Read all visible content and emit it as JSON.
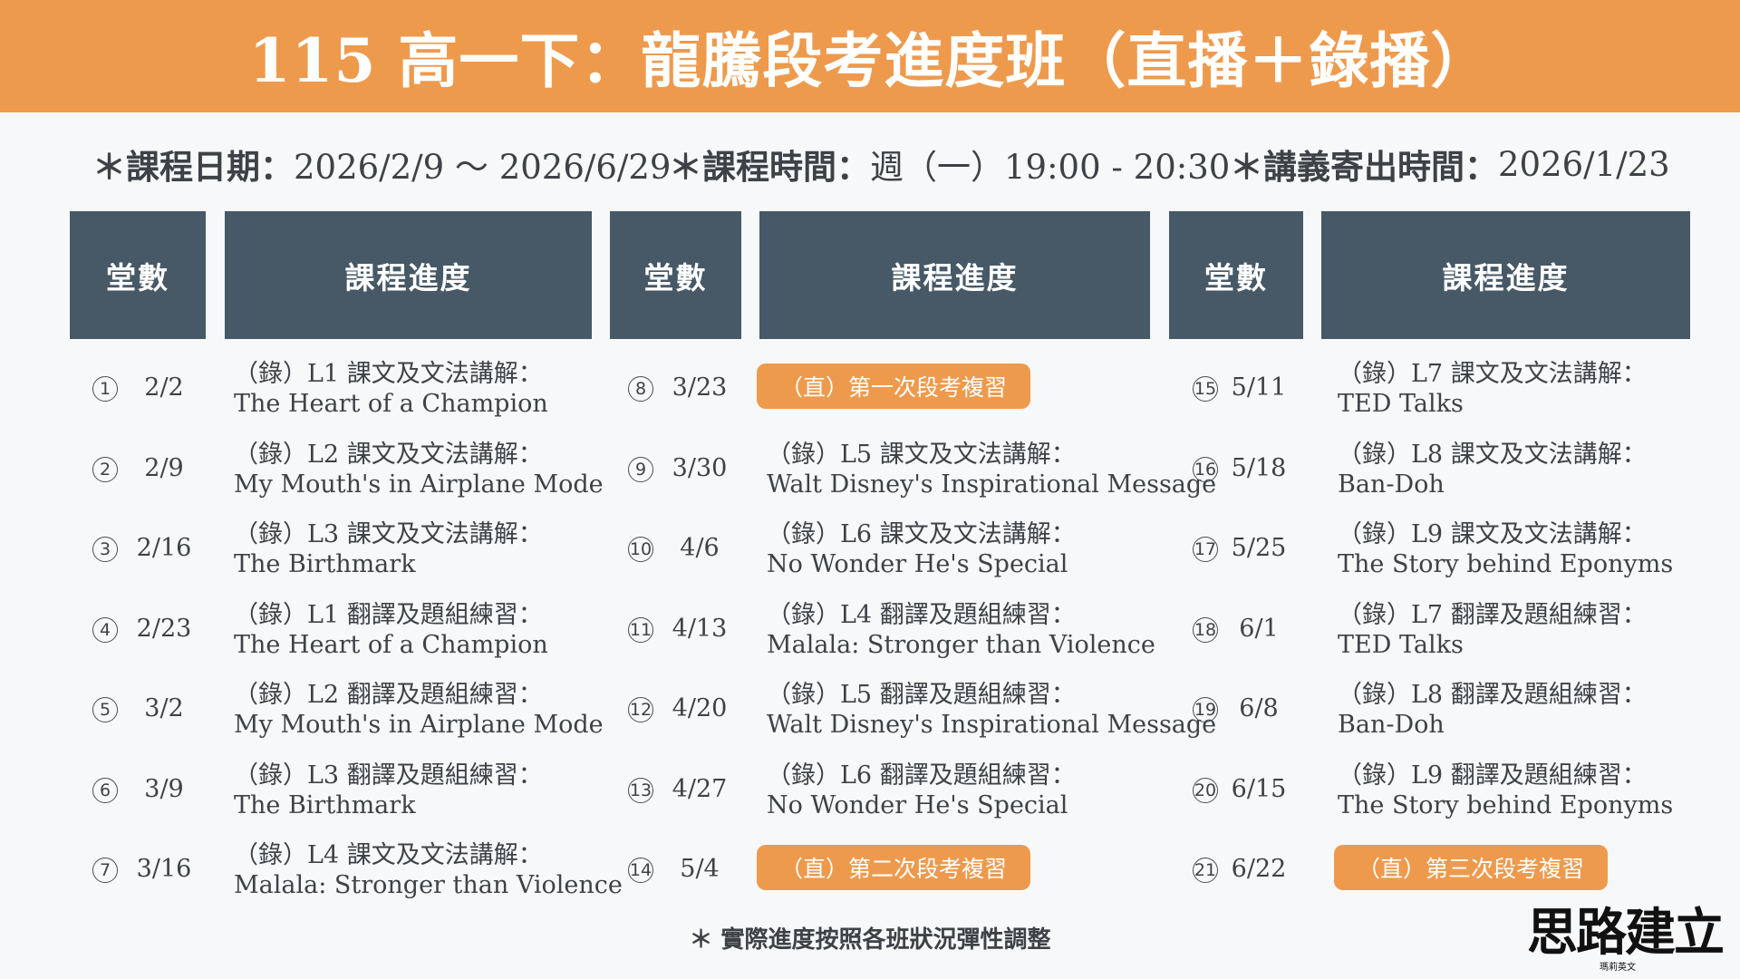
{
  "title": "115 高一下：龍騰段考進度班（直播＋錄播）",
  "info": {
    "date_label": "＊課程日期：",
    "date_value": "2026/2/9 ～ 2026/6/29",
    "time_label": "＊課程時間：",
    "time_value": "週（一）19:00 - 20:30",
    "ship_label": "＊講義寄出時間：",
    "ship_value": "2026/1/23"
  },
  "headers": {
    "count": "堂數",
    "progress": "課程進度"
  },
  "columns": [
    {
      "rows": [
        {
          "num": "1",
          "date": "2/2",
          "line1": "（錄）L1 課文及文法講解：",
          "line2": "The Heart of a Champion"
        },
        {
          "num": "2",
          "date": "2/9",
          "line1": "（錄）L2 課文及文法講解：",
          "line2": "My Mouth's in Airplane Mode"
        },
        {
          "num": "3",
          "date": "2/16",
          "line1": "（錄）L3 課文及文法講解：",
          "line2": "The Birthmark"
        },
        {
          "num": "4",
          "date": "2/23",
          "line1": "（錄）L1 翻譯及題組練習：",
          "line2": "The Heart of a Champion"
        },
        {
          "num": "5",
          "date": "3/2",
          "line1": "（錄）L2 翻譯及題組練習：",
          "line2": "My Mouth's in Airplane Mode"
        },
        {
          "num": "6",
          "date": "3/9",
          "line1": "（錄）L3 翻譯及題組練習：",
          "line2": "The Birthmark"
        },
        {
          "num": "7",
          "date": "3/16",
          "line1": "（錄）L4 課文及文法講解：",
          "line2": "Malala: Stronger than Violence"
        }
      ]
    },
    {
      "rows": [
        {
          "num": "8",
          "date": "3/23",
          "pill": "（直）第一次段考複習"
        },
        {
          "num": "9",
          "date": "3/30",
          "line1": "（錄）L5 課文及文法講解：",
          "line2": "Walt Disney's Inspirational Message"
        },
        {
          "num": "10",
          "date": "4/6",
          "line1": "（錄）L6 課文及文法講解：",
          "line2": "No Wonder He's Special"
        },
        {
          "num": "11",
          "date": "4/13",
          "line1": "（錄）L4 翻譯及題組練習：",
          "line2": "Malala: Stronger than Violence"
        },
        {
          "num": "12",
          "date": "4/20",
          "line1": "（錄）L5 翻譯及題組練習：",
          "line2": "Walt Disney's Inspirational Message"
        },
        {
          "num": "13",
          "date": "4/27",
          "line1": "（錄）L6 翻譯及題組練習：",
          "line2": "No Wonder He's Special"
        },
        {
          "num": "14",
          "date": "5/4",
          "pill": "（直）第二次段考複習"
        }
      ]
    },
    {
      "rows": [
        {
          "num": "15",
          "date": "5/11",
          "line1": "（錄）L7 課文及文法講解：",
          "line2": "TED Talks"
        },
        {
          "num": "16",
          "date": "5/18",
          "line1": "（錄）L8 課文及文法講解：",
          "line2": "Ban-Doh"
        },
        {
          "num": "17",
          "date": "5/25",
          "line1": "（錄）L9 課文及文法講解：",
          "line2": "The Story behind Eponyms"
        },
        {
          "num": "18",
          "date": "6/1",
          "line1": "（錄）L7 翻譯及題組練習：",
          "line2": "TED Talks"
        },
        {
          "num": "19",
          "date": "6/8",
          "line1": "（錄）L8 翻譯及題組練習：",
          "line2": "Ban-Doh"
        },
        {
          "num": "20",
          "date": "6/15",
          "line1": "（錄）L9 翻譯及題組練習：",
          "line2": "The Story behind Eponyms"
        },
        {
          "num": "21",
          "date": "6/22",
          "pill": "（直）第三次段考複習"
        }
      ]
    }
  ],
  "note": "＊ 實際進度按照各班狀況彈性調整",
  "logo": {
    "mark": "思路建立",
    "sub": "瑪莉英文"
  },
  "colors": {
    "accent": "#ee9a4d",
    "header": "#475967"
  }
}
